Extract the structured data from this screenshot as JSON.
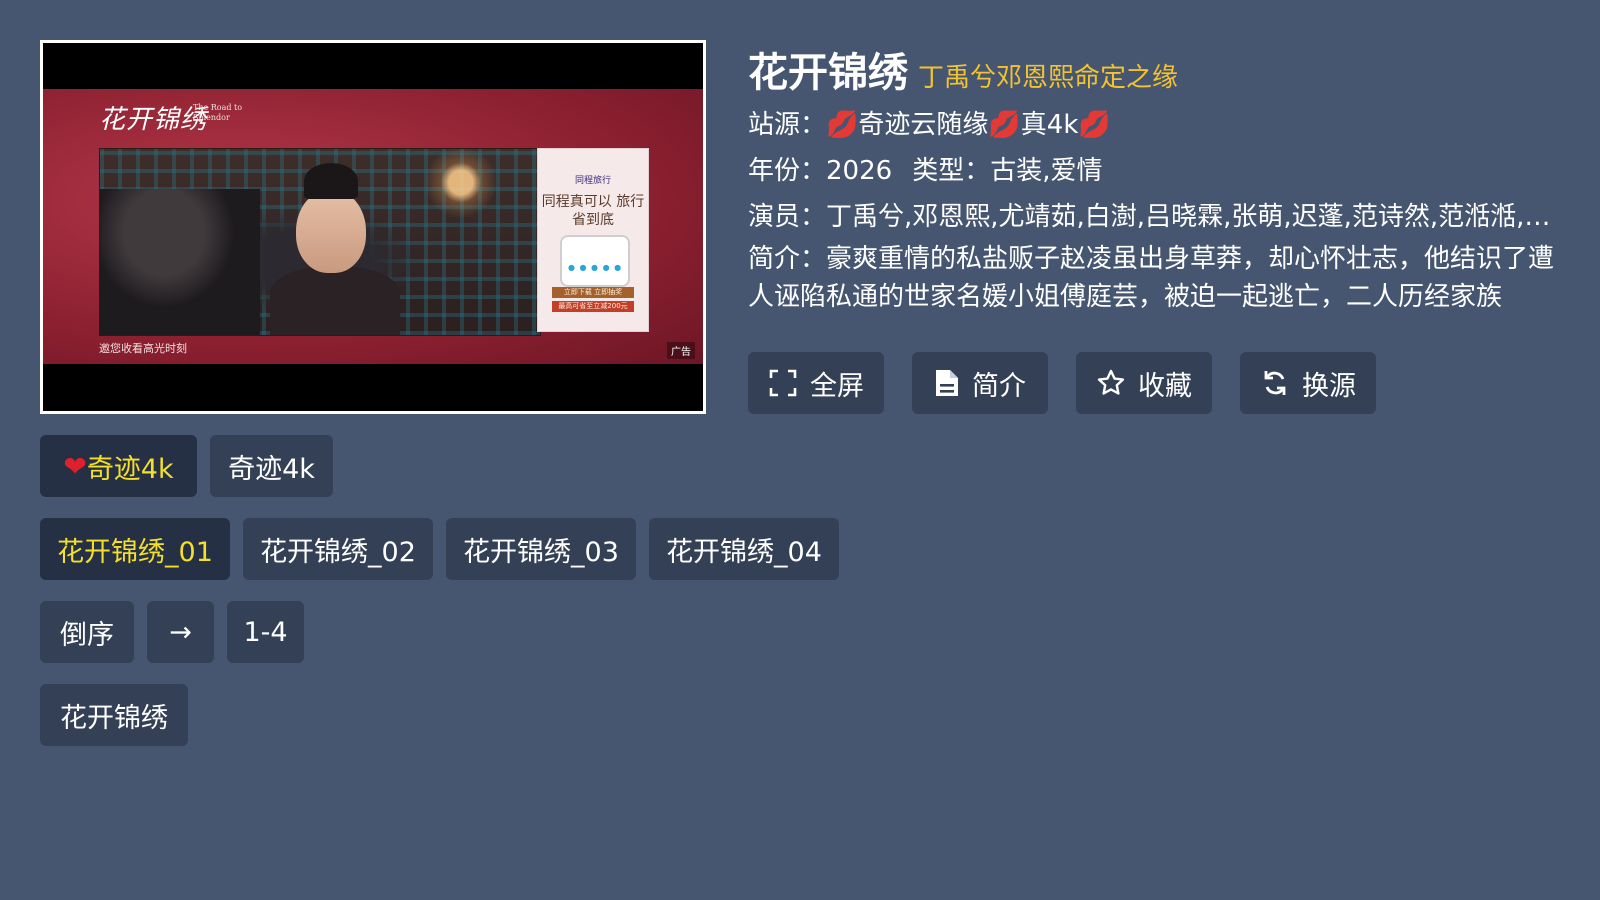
{
  "player": {
    "brand": "花开锦绣",
    "brand_sub": "The Road to Splendor",
    "ad_logo": "同程旅行",
    "ad_title": "同程真可以 旅行省到底",
    "ad_btn1": "立即下载 立即抽奖",
    "ad_btn2": "最高可省至立减200元",
    "subtitle": "邀您收看高光时刻",
    "ad_tag": "广告"
  },
  "info": {
    "title": "花开锦绣",
    "slogan": "丁禹兮邓恩熙命定之缘",
    "source_label": "站源：",
    "source_value": "奇迹云随缘",
    "source_value2": "真4k",
    "year_label": "年份：",
    "year_value": "2026",
    "type_label": "类型：",
    "type_value": "古装,爱情",
    "cast_label": "演员：",
    "cast_value": "丁禹兮,邓恩熙,尤靖茹,白澍,吕晓霖,张萌,迟蓬,范诗然,范湉湉,…",
    "intro_label": "简介：",
    "intro_value": "豪爽重情的私盐贩子赵凌虽出身草莽，却心怀壮志，他结识了遭人诬陷私通的世家名媛小姐傅庭芸，被迫一起逃亡，二人历经家族"
  },
  "actions": {
    "fullscreen": "全屏",
    "intro": "简介",
    "favorite": "收藏",
    "switch_source": "换源"
  },
  "sources": [
    {
      "label": "奇迹4k",
      "icon": "heart-icon"
    },
    {
      "label": "奇迹4k"
    }
  ],
  "episodes": [
    "花开锦绣_01",
    "花开锦绣_02",
    "花开锦绣_03",
    "花开锦绣_04"
  ],
  "controls": {
    "reverse": "倒序",
    "arrow": "→",
    "range": "1-4"
  },
  "related": [
    "花开锦绣"
  ],
  "colors": {
    "background": "#465670",
    "button": "#344055",
    "button_selected": "#253044",
    "accent_text": "#f4df2a",
    "slogan": "#f1c232"
  }
}
